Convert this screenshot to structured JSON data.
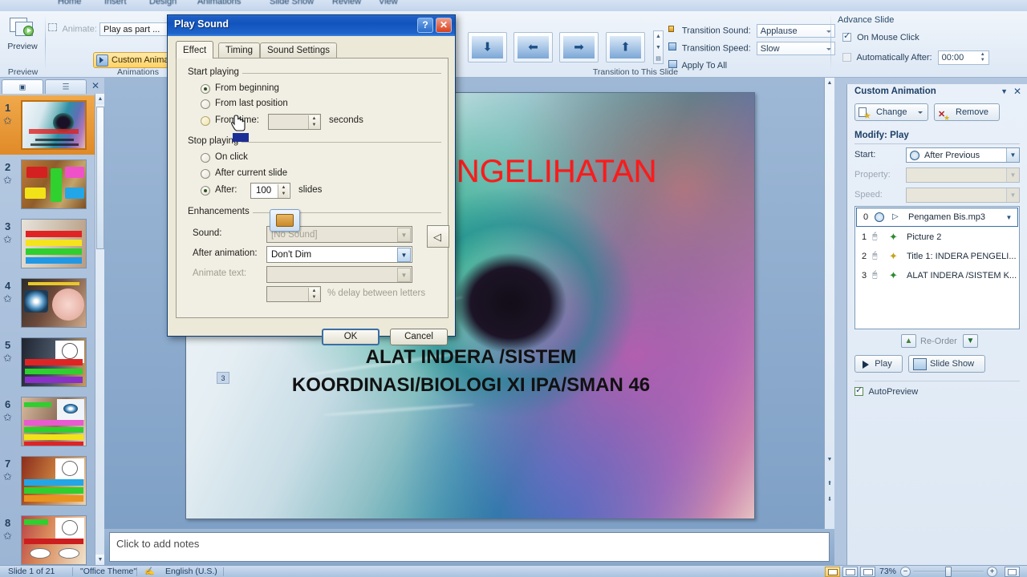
{
  "app": {
    "tabs": [
      "Home",
      "Insert",
      "Design",
      "Animations",
      "Slide Show",
      "Review",
      "View"
    ],
    "active_tab": "Animations"
  },
  "ribbon": {
    "preview": {
      "label": "Preview",
      "group_label": "Preview"
    },
    "animations": {
      "group_label": "Animations",
      "animate_label": "Animate:",
      "animate_value": "Play as part ...",
      "custom_animation_label": "Custom Animation"
    },
    "transition": {
      "group_label": "Transition to This Slide",
      "sound_label": "Transition Sound:",
      "sound_value": "Applause",
      "speed_label": "Transition Speed:",
      "speed_value": "Slow",
      "apply_all_label": "Apply To All",
      "gallery_icons": [
        "wipe-down",
        "wipe-left",
        "wipe-right",
        "wipe-up"
      ]
    },
    "advance": {
      "group_label": "Advance Slide",
      "on_mouse_click_label": "On Mouse Click",
      "on_mouse_click_checked": true,
      "automatically_after_label": "Automatically After:",
      "automatically_after_checked": false,
      "automatically_after_value": "00:00"
    }
  },
  "slide_panel": {
    "tabs": [
      "slides-tab",
      "outline-tab"
    ],
    "close_label": "✕",
    "thumbnails": [
      {
        "number": "1",
        "selected": true
      },
      {
        "number": "2",
        "selected": false
      },
      {
        "number": "3",
        "selected": false
      },
      {
        "number": "4",
        "selected": false
      },
      {
        "number": "5",
        "selected": false
      },
      {
        "number": "6",
        "selected": false
      },
      {
        "number": "7",
        "selected": false
      },
      {
        "number": "8",
        "selected": false
      }
    ]
  },
  "slide": {
    "title": "INDERA PENGELIHATAN",
    "title_color": "#ff1a1a",
    "subtitle_line1": "ALAT INDERA /SISTEM",
    "subtitle_line2": "KOORDINASI/BIOLOGI XI IPA/SMAN 46",
    "placeholder_badge": "3"
  },
  "notes": {
    "placeholder": "Click to add notes"
  },
  "task_pane": {
    "title": "Custom Animation",
    "collapse_icon": "▼",
    "close_icon": "✕",
    "change_label": "Change",
    "remove_label": "Remove",
    "modify_label": "Modify: Play",
    "start_label": "Start:",
    "start_value": "After Previous",
    "property_label": "Property:",
    "property_value": "",
    "speed_label": "Speed:",
    "speed_value": "",
    "items": [
      {
        "index": "0",
        "trigger": "clock",
        "effect": "media-play",
        "text": "Pengamen Bis.mp3",
        "selected": true
      },
      {
        "index": "1",
        "trigger": "mouse",
        "effect": "star-green",
        "text": "Picture 2",
        "selected": false
      },
      {
        "index": "2",
        "trigger": "mouse",
        "effect": "star-yellow",
        "text": "Title 1: INDERA PENGELI...",
        "selected": false
      },
      {
        "index": "3",
        "trigger": "mouse",
        "effect": "star-green",
        "text": "ALAT INDERA /SISTEM K...",
        "selected": false
      }
    ],
    "reorder_label": "Re-Order",
    "reorder_up": "▲",
    "reorder_down": "▼",
    "play_label": "Play",
    "slide_show_label": "Slide Show",
    "autopreview_label": "AutoPreview",
    "autopreview_checked": true
  },
  "dialog": {
    "title": "Play Sound",
    "help_icon": "?",
    "close_icon": "✕",
    "tabs": [
      {
        "label": "Effect",
        "selected": true
      },
      {
        "label": "Timing",
        "selected": false
      },
      {
        "label": "Sound Settings",
        "selected": false
      }
    ],
    "start_playing": {
      "group_label": "Start playing",
      "options": [
        {
          "label": "From beginning",
          "selected": true
        },
        {
          "label": "From last position",
          "selected": false
        },
        {
          "label": "From time:",
          "selected": false
        }
      ],
      "time_value": "",
      "seconds_label": "seconds"
    },
    "stop_playing": {
      "group_label": "Stop playing",
      "options": [
        {
          "label": "On click",
          "selected": false
        },
        {
          "label": "After current slide",
          "selected": false
        },
        {
          "label": "After:",
          "selected": true
        }
      ],
      "after_value": "100",
      "slides_label": "slides"
    },
    "enhancements": {
      "group_label": "Enhancements",
      "sound_label": "Sound:",
      "sound_value": "[No Sound]",
      "after_animation_label": "After animation:",
      "after_animation_value": "Don't Dim",
      "animate_text_label": "Animate text:",
      "animate_text_value": "",
      "delay_value": "",
      "delay_label": "% delay between letters"
    },
    "ok_label": "OK",
    "cancel_label": "Cancel"
  },
  "status_bar": {
    "slide_counter": "Slide 1 of 21",
    "theme": "\"Office Theme\"",
    "language": "English (U.S.)",
    "zoom_percent": "73%",
    "zoom_out": "−",
    "zoom_in": "+"
  }
}
